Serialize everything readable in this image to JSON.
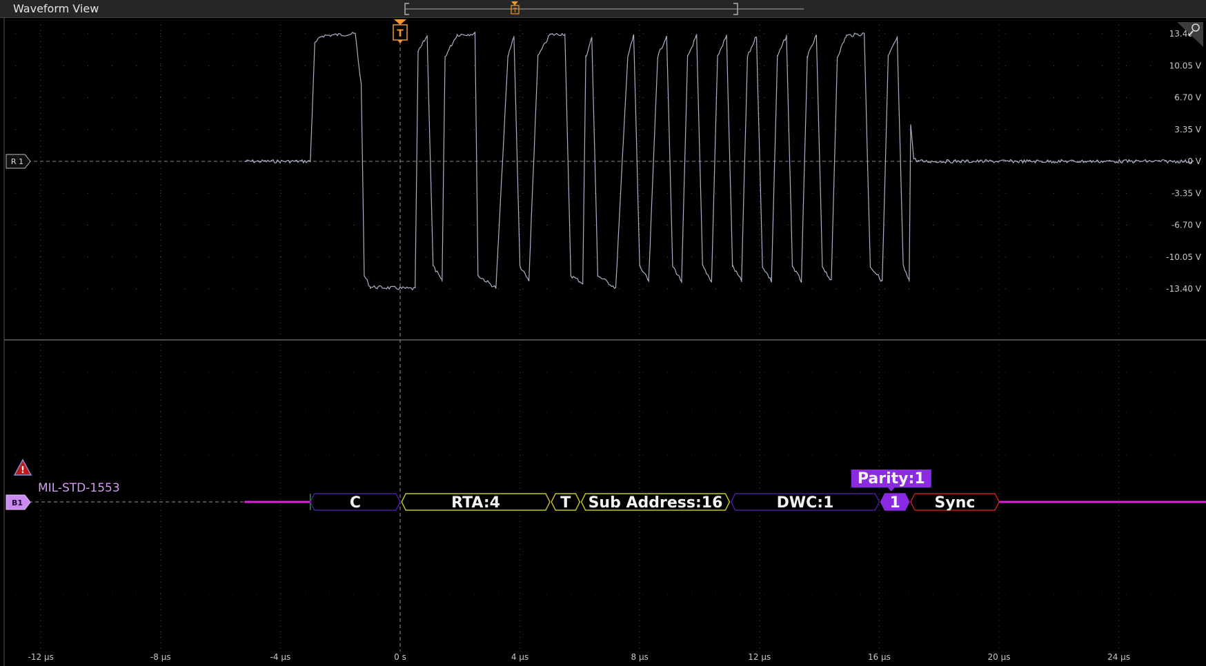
{
  "window": {
    "title": "Waveform View"
  },
  "colors": {
    "background": "#000000",
    "grid": "#5a5a5a",
    "waveform": "#aab2c6",
    "trigger": "#f0962a",
    "bus_line": "#e020e0",
    "bus_badge": "#c98bf0",
    "control_color": "#4a1c9c",
    "address_color": "#c8c81e",
    "sync_color": "#cc1c1c",
    "parity_fill": "#8a2be2"
  },
  "trigger_marker": {
    "label": "T"
  },
  "channel": {
    "label": "R 1"
  },
  "bus": {
    "badge": "B1",
    "protocol": "MIL-STD-1553",
    "warning_icon": "warning-triangle-icon"
  },
  "icons": {
    "zoom": "zoom-magnifier-icon"
  },
  "chart_data": {
    "type": "line",
    "x_unit": "µs",
    "y_unit": "V",
    "xlim": [
      -14.0,
      26.5
    ],
    "ylim": [
      -16.75,
      16.75
    ],
    "grid": true,
    "x_ticks": [
      -12,
      -8,
      -4,
      0,
      4,
      8,
      12,
      16,
      20,
      24
    ],
    "x_tick_labels": [
      "-12 µs",
      "-8 µs",
      "-4 µs",
      "0 s",
      "4 µs",
      "8 µs",
      "12 µs",
      "16 µs",
      "20 µs",
      "24 µs"
    ],
    "y_ticks": [
      13.4,
      10.05,
      6.7,
      3.35,
      0,
      -3.35,
      -6.7,
      -10.05,
      -13.4
    ],
    "y_tick_labels": [
      "13.40 V",
      "10.05 V",
      "6.70 V",
      "3.35 V",
      "0 V",
      "-3.35 V",
      "-6.70 V",
      "-10.05 V",
      "-13.40 V"
    ],
    "series": [
      {
        "points": [
          [
            -5.2,
            0
          ],
          [
            -3.0,
            0
          ],
          [
            -2.85,
            12.4
          ],
          [
            -2.6,
            13.2
          ],
          [
            -1.5,
            13.4
          ],
          [
            -1.3,
            8.0
          ],
          [
            -1.2,
            -12.0
          ],
          [
            -1.0,
            -13.2
          ],
          [
            0.5,
            -13.4
          ],
          [
            0.6,
            11.5
          ],
          [
            0.9,
            13.2
          ],
          [
            1.1,
            -11.0
          ],
          [
            1.4,
            -12.6
          ],
          [
            1.5,
            11.0
          ],
          [
            1.9,
            13.3
          ],
          [
            2.5,
            13.4
          ],
          [
            2.6,
            -12.0
          ],
          [
            3.2,
            -13.3
          ],
          [
            3.6,
            11.0
          ],
          [
            3.8,
            13.2
          ],
          [
            4.0,
            -11.0
          ],
          [
            4.3,
            -12.6
          ],
          [
            4.6,
            11.0
          ],
          [
            5.0,
            13.3
          ],
          [
            5.5,
            13.4
          ],
          [
            5.7,
            -12.0
          ],
          [
            6.1,
            -12.8
          ],
          [
            6.2,
            11.0
          ],
          [
            6.4,
            13.0
          ],
          [
            6.6,
            -12.0
          ],
          [
            7.2,
            -13.3
          ],
          [
            7.6,
            11.0
          ],
          [
            7.8,
            13.2
          ],
          [
            8.0,
            -11.0
          ],
          [
            8.3,
            -12.6
          ],
          [
            8.6,
            11.0
          ],
          [
            8.9,
            13.2
          ],
          [
            9.1,
            -11.0
          ],
          [
            9.4,
            -12.6
          ],
          [
            9.6,
            11.0
          ],
          [
            9.9,
            13.2
          ],
          [
            10.1,
            -11.0
          ],
          [
            10.4,
            -12.6
          ],
          [
            10.6,
            11.0
          ],
          [
            10.9,
            13.2
          ],
          [
            11.1,
            -11.0
          ],
          [
            11.4,
            -12.6
          ],
          [
            11.6,
            11.0
          ],
          [
            11.9,
            13.2
          ],
          [
            12.1,
            -11.0
          ],
          [
            12.4,
            -12.6
          ],
          [
            12.6,
            11.0
          ],
          [
            12.9,
            13.2
          ],
          [
            13.1,
            -11.0
          ],
          [
            13.4,
            -12.6
          ],
          [
            13.6,
            11.0
          ],
          [
            13.9,
            13.2
          ],
          [
            14.1,
            -11.0
          ],
          [
            14.4,
            -12.6
          ],
          [
            14.6,
            11.0
          ],
          [
            14.9,
            13.2
          ],
          [
            15.5,
            13.4
          ],
          [
            15.7,
            -11.0
          ],
          [
            16.1,
            -12.6
          ],
          [
            16.3,
            11.0
          ],
          [
            16.6,
            13.0
          ],
          [
            16.8,
            -11.0
          ],
          [
            17.0,
            -12.6
          ],
          [
            17.05,
            4.0
          ],
          [
            17.15,
            0.3
          ],
          [
            17.3,
            0
          ],
          [
            26.5,
            0
          ]
        ]
      }
    ]
  },
  "decode": {
    "x_unit": "µs",
    "bus_start": -5.2,
    "bus_end": 26.5,
    "segments": [
      {
        "label": "C",
        "start": -3.0,
        "end": 0.0,
        "kind": "control"
      },
      {
        "label": "RTA:4",
        "start": 0.05,
        "end": 5.0,
        "kind": "address"
      },
      {
        "label": "T",
        "start": 5.05,
        "end": 6.0,
        "kind": "address"
      },
      {
        "label": "Sub Address:16",
        "start": 6.05,
        "end": 11.0,
        "kind": "address"
      },
      {
        "label": "DWC:1",
        "start": 11.05,
        "end": 16.0,
        "kind": "control"
      },
      {
        "label": "1",
        "start": 16.05,
        "end": 17.0,
        "kind": "parity"
      },
      {
        "label": "Sync",
        "start": 17.05,
        "end": 20.0,
        "kind": "sync"
      }
    ],
    "callout": {
      "label": "Parity:1",
      "at": 16.4
    }
  },
  "overview": {
    "bracket_start_frac": 0.0,
    "bracket_end_frac": 0.78
  }
}
